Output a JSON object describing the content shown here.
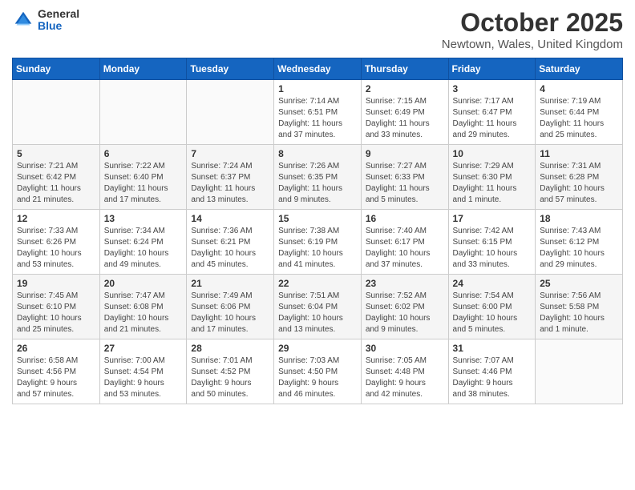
{
  "logo": {
    "general": "General",
    "blue": "Blue"
  },
  "title": "October 2025",
  "location": "Newtown, Wales, United Kingdom",
  "days_of_week": [
    "Sunday",
    "Monday",
    "Tuesday",
    "Wednesday",
    "Thursday",
    "Friday",
    "Saturday"
  ],
  "weeks": [
    [
      {
        "day": "",
        "info": ""
      },
      {
        "day": "",
        "info": ""
      },
      {
        "day": "",
        "info": ""
      },
      {
        "day": "1",
        "info": "Sunrise: 7:14 AM\nSunset: 6:51 PM\nDaylight: 11 hours\nand 37 minutes."
      },
      {
        "day": "2",
        "info": "Sunrise: 7:15 AM\nSunset: 6:49 PM\nDaylight: 11 hours\nand 33 minutes."
      },
      {
        "day": "3",
        "info": "Sunrise: 7:17 AM\nSunset: 6:47 PM\nDaylight: 11 hours\nand 29 minutes."
      },
      {
        "day": "4",
        "info": "Sunrise: 7:19 AM\nSunset: 6:44 PM\nDaylight: 11 hours\nand 25 minutes."
      }
    ],
    [
      {
        "day": "5",
        "info": "Sunrise: 7:21 AM\nSunset: 6:42 PM\nDaylight: 11 hours\nand 21 minutes."
      },
      {
        "day": "6",
        "info": "Sunrise: 7:22 AM\nSunset: 6:40 PM\nDaylight: 11 hours\nand 17 minutes."
      },
      {
        "day": "7",
        "info": "Sunrise: 7:24 AM\nSunset: 6:37 PM\nDaylight: 11 hours\nand 13 minutes."
      },
      {
        "day": "8",
        "info": "Sunrise: 7:26 AM\nSunset: 6:35 PM\nDaylight: 11 hours\nand 9 minutes."
      },
      {
        "day": "9",
        "info": "Sunrise: 7:27 AM\nSunset: 6:33 PM\nDaylight: 11 hours\nand 5 minutes."
      },
      {
        "day": "10",
        "info": "Sunrise: 7:29 AM\nSunset: 6:30 PM\nDaylight: 11 hours\nand 1 minute."
      },
      {
        "day": "11",
        "info": "Sunrise: 7:31 AM\nSunset: 6:28 PM\nDaylight: 10 hours\nand 57 minutes."
      }
    ],
    [
      {
        "day": "12",
        "info": "Sunrise: 7:33 AM\nSunset: 6:26 PM\nDaylight: 10 hours\nand 53 minutes."
      },
      {
        "day": "13",
        "info": "Sunrise: 7:34 AM\nSunset: 6:24 PM\nDaylight: 10 hours\nand 49 minutes."
      },
      {
        "day": "14",
        "info": "Sunrise: 7:36 AM\nSunset: 6:21 PM\nDaylight: 10 hours\nand 45 minutes."
      },
      {
        "day": "15",
        "info": "Sunrise: 7:38 AM\nSunset: 6:19 PM\nDaylight: 10 hours\nand 41 minutes."
      },
      {
        "day": "16",
        "info": "Sunrise: 7:40 AM\nSunset: 6:17 PM\nDaylight: 10 hours\nand 37 minutes."
      },
      {
        "day": "17",
        "info": "Sunrise: 7:42 AM\nSunset: 6:15 PM\nDaylight: 10 hours\nand 33 minutes."
      },
      {
        "day": "18",
        "info": "Sunrise: 7:43 AM\nSunset: 6:12 PM\nDaylight: 10 hours\nand 29 minutes."
      }
    ],
    [
      {
        "day": "19",
        "info": "Sunrise: 7:45 AM\nSunset: 6:10 PM\nDaylight: 10 hours\nand 25 minutes."
      },
      {
        "day": "20",
        "info": "Sunrise: 7:47 AM\nSunset: 6:08 PM\nDaylight: 10 hours\nand 21 minutes."
      },
      {
        "day": "21",
        "info": "Sunrise: 7:49 AM\nSunset: 6:06 PM\nDaylight: 10 hours\nand 17 minutes."
      },
      {
        "day": "22",
        "info": "Sunrise: 7:51 AM\nSunset: 6:04 PM\nDaylight: 10 hours\nand 13 minutes."
      },
      {
        "day": "23",
        "info": "Sunrise: 7:52 AM\nSunset: 6:02 PM\nDaylight: 10 hours\nand 9 minutes."
      },
      {
        "day": "24",
        "info": "Sunrise: 7:54 AM\nSunset: 6:00 PM\nDaylight: 10 hours\nand 5 minutes."
      },
      {
        "day": "25",
        "info": "Sunrise: 7:56 AM\nSunset: 5:58 PM\nDaylight: 10 hours\nand 1 minute."
      }
    ],
    [
      {
        "day": "26",
        "info": "Sunrise: 6:58 AM\nSunset: 4:56 PM\nDaylight: 9 hours\nand 57 minutes."
      },
      {
        "day": "27",
        "info": "Sunrise: 7:00 AM\nSunset: 4:54 PM\nDaylight: 9 hours\nand 53 minutes."
      },
      {
        "day": "28",
        "info": "Sunrise: 7:01 AM\nSunset: 4:52 PM\nDaylight: 9 hours\nand 50 minutes."
      },
      {
        "day": "29",
        "info": "Sunrise: 7:03 AM\nSunset: 4:50 PM\nDaylight: 9 hours\nand 46 minutes."
      },
      {
        "day": "30",
        "info": "Sunrise: 7:05 AM\nSunset: 4:48 PM\nDaylight: 9 hours\nand 42 minutes."
      },
      {
        "day": "31",
        "info": "Sunrise: 7:07 AM\nSunset: 4:46 PM\nDaylight: 9 hours\nand 38 minutes."
      },
      {
        "day": "",
        "info": ""
      }
    ]
  ]
}
